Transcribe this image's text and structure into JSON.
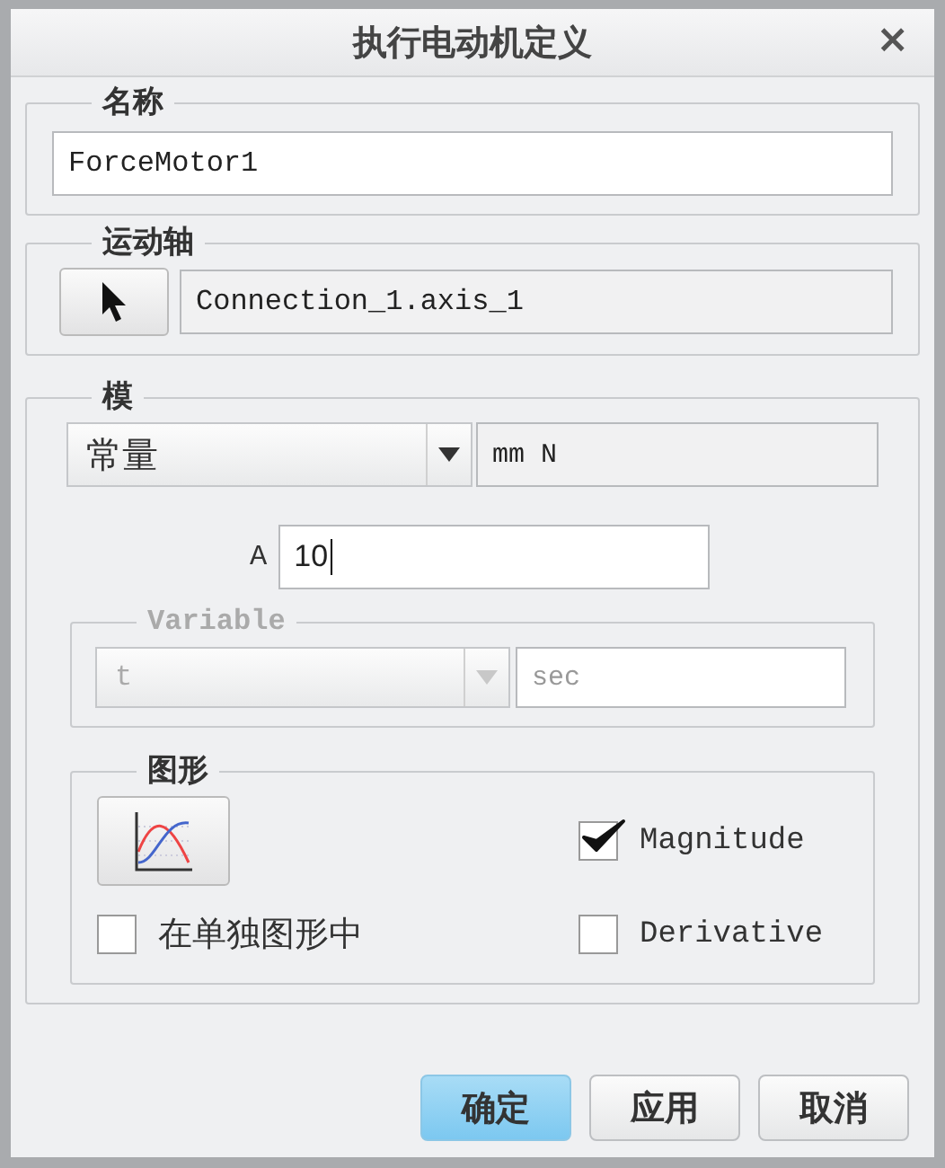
{
  "window": {
    "title": "执行电动机定义",
    "close": "×"
  },
  "name_group": {
    "legend": "名称",
    "value": "ForceMotor1"
  },
  "axis_group": {
    "legend": "运动轴",
    "value": "Connection_1.axis_1"
  },
  "magnitude_group": {
    "legend": "模",
    "function_type": "常量",
    "units": "mm N",
    "parameters": [
      {
        "label": "A",
        "value": "10"
      }
    ],
    "variable": {
      "legend": "Variable",
      "disabled": true,
      "value": "t",
      "units": "sec"
    },
    "graph": {
      "legend": "图形",
      "options": [
        {
          "label": "在单独图形中",
          "checked": false
        },
        {
          "label": "Magnitude",
          "checked": true
        },
        {
          "label": "Derivative",
          "checked": false
        }
      ]
    }
  },
  "buttons": [
    {
      "label": "确定",
      "selected": true
    },
    {
      "label": "应用",
      "selected": false
    },
    {
      "label": "取消",
      "selected": false
    }
  ]
}
